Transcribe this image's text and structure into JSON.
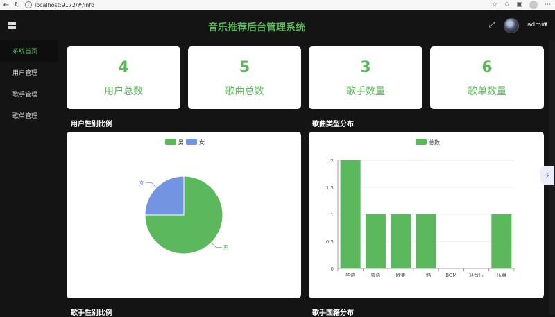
{
  "browser": {
    "url": "localhost:9172/#/info"
  },
  "header": {
    "title": "音乐推荐后台管理系统",
    "user": "admin"
  },
  "sidebar": {
    "items": [
      {
        "label": "系统首页",
        "active": true
      },
      {
        "label": "用户管理",
        "active": false
      },
      {
        "label": "歌手管理",
        "active": false
      },
      {
        "label": "歌单管理",
        "active": false
      }
    ]
  },
  "stats": [
    {
      "value": "4",
      "label": "用户总数"
    },
    {
      "value": "5",
      "label": "歌曲总数"
    },
    {
      "value": "3",
      "label": "歌手数量"
    },
    {
      "value": "6",
      "label": "歌单数量"
    }
  ],
  "sections": {
    "gender_title": "用户性别比例",
    "genre_title": "歌曲类型分布",
    "singer_gender_title": "歌手性别比例",
    "singer_country_title": "歌手国籍分布"
  },
  "colors": {
    "accent": "#5cb85c",
    "blue": "#7394e0"
  },
  "chart_data": [
    {
      "type": "pie",
      "legend": [
        "男",
        "女"
      ],
      "slices": [
        {
          "name": "男",
          "value": 3
        },
        {
          "name": "女",
          "value": 1
        }
      ],
      "legend_position": "top-center"
    },
    {
      "type": "bar",
      "legend": [
        "总数"
      ],
      "categories": [
        "华语",
        "粤语",
        "欧美",
        "日韩",
        "BGM",
        "轻音乐",
        "乐器"
      ],
      "series": [
        {
          "name": "总数",
          "values": [
            2,
            1,
            1,
            1,
            0,
            0,
            1
          ]
        }
      ],
      "yticks": [
        "0",
        "0.5",
        "1",
        "1.5",
        "2"
      ],
      "ylim": [
        0,
        2
      ],
      "grid": true,
      "legend_position": "top-center"
    }
  ]
}
